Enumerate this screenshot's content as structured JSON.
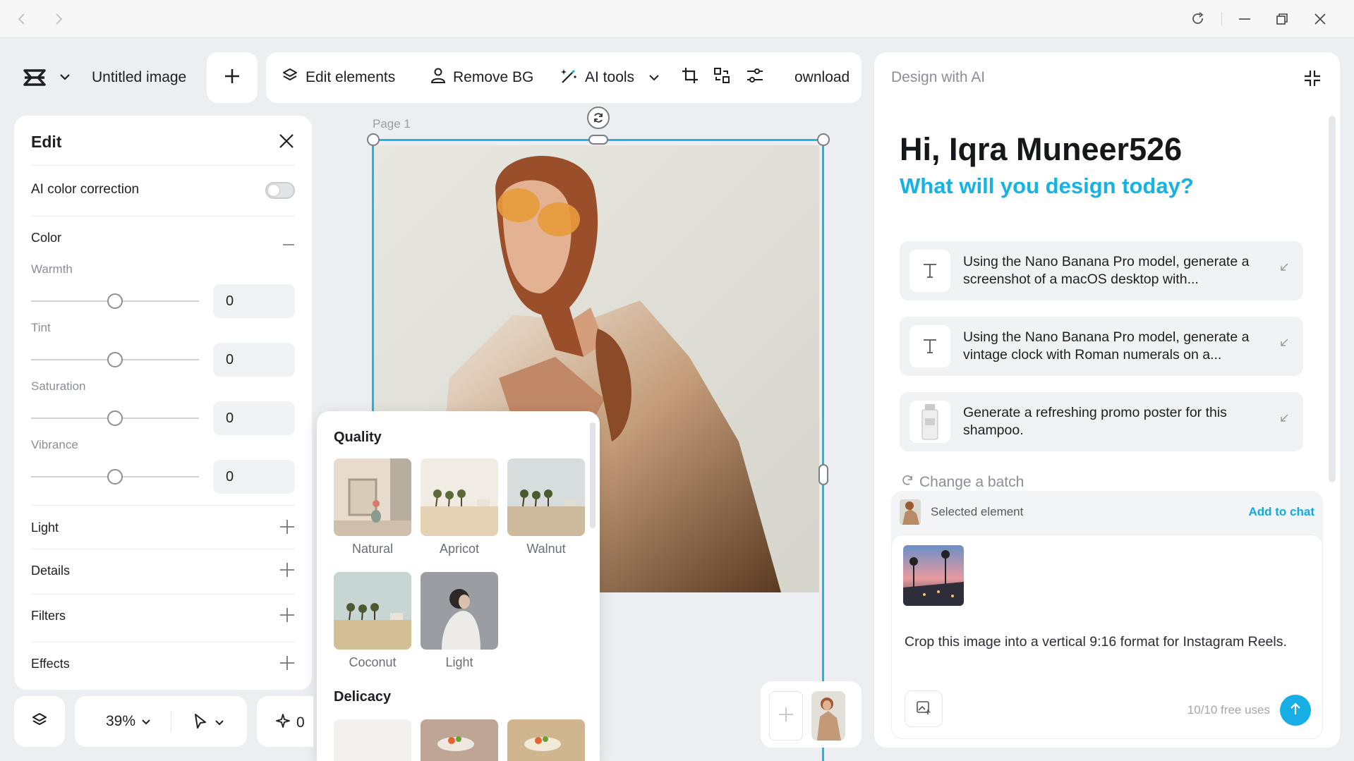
{
  "window": {
    "back_icon": "chevron-left-icon",
    "forward_icon": "chevron-right-icon",
    "reload_icon": "reload-icon",
    "minimize_icon": "minimize-icon",
    "restore_icon": "restore-icon",
    "close_icon": "close-icon"
  },
  "toolbar": {
    "doc_title": "Untitled image",
    "edit_elements": "Edit elements",
    "remove_bg": "Remove BG",
    "ai_tools": "AI tools",
    "download": "ownload"
  },
  "canvas": {
    "page_label": "Page 1"
  },
  "edit_panel": {
    "title": "Edit",
    "ai_color_correction": "AI color correction",
    "ai_color_correction_on": false,
    "color_section": "Color",
    "adjustments": [
      {
        "label": "Warmth",
        "value": "0"
      },
      {
        "label": "Tint",
        "value": "0"
      },
      {
        "label": "Saturation",
        "value": "0"
      },
      {
        "label": "Vibrance",
        "value": "0"
      }
    ],
    "sections": [
      "Light",
      "Details",
      "Filters",
      "Effects"
    ]
  },
  "quality_popup": {
    "title": "Quality",
    "presets": [
      "Natural",
      "Apricot",
      "Walnut",
      "Coconut",
      "Light"
    ],
    "delicacy_title": "Delicacy"
  },
  "ai_panel": {
    "header": "Design with AI",
    "greeting": "Hi, Iqra Muneer526",
    "subheading": "What will you design today?",
    "suggestions": [
      {
        "text": "Using the Nano Banana Pro model, generate a screenshot of a macOS desktop with...",
        "icon": "text-icon"
      },
      {
        "text": "Using the Nano Banana Pro model, generate a vintage clock with Roman numerals on a...",
        "icon": "text-icon"
      },
      {
        "text": "Generate a refreshing promo poster for this shampoo.",
        "icon": "shampoo-thumbnail"
      }
    ],
    "change_batch": "Change a batch",
    "selected_element": "Selected element",
    "add_to_chat": "Add to chat",
    "prompt_text": "Crop this image into a vertical 9:16 format for Instagram Reels.",
    "free_uses": "10/10 free uses"
  },
  "bottom_bar": {
    "zoom": "39%",
    "star_count": "0"
  },
  "colors": {
    "accent": "#16b2e3",
    "selection": "#1fb5e4"
  }
}
